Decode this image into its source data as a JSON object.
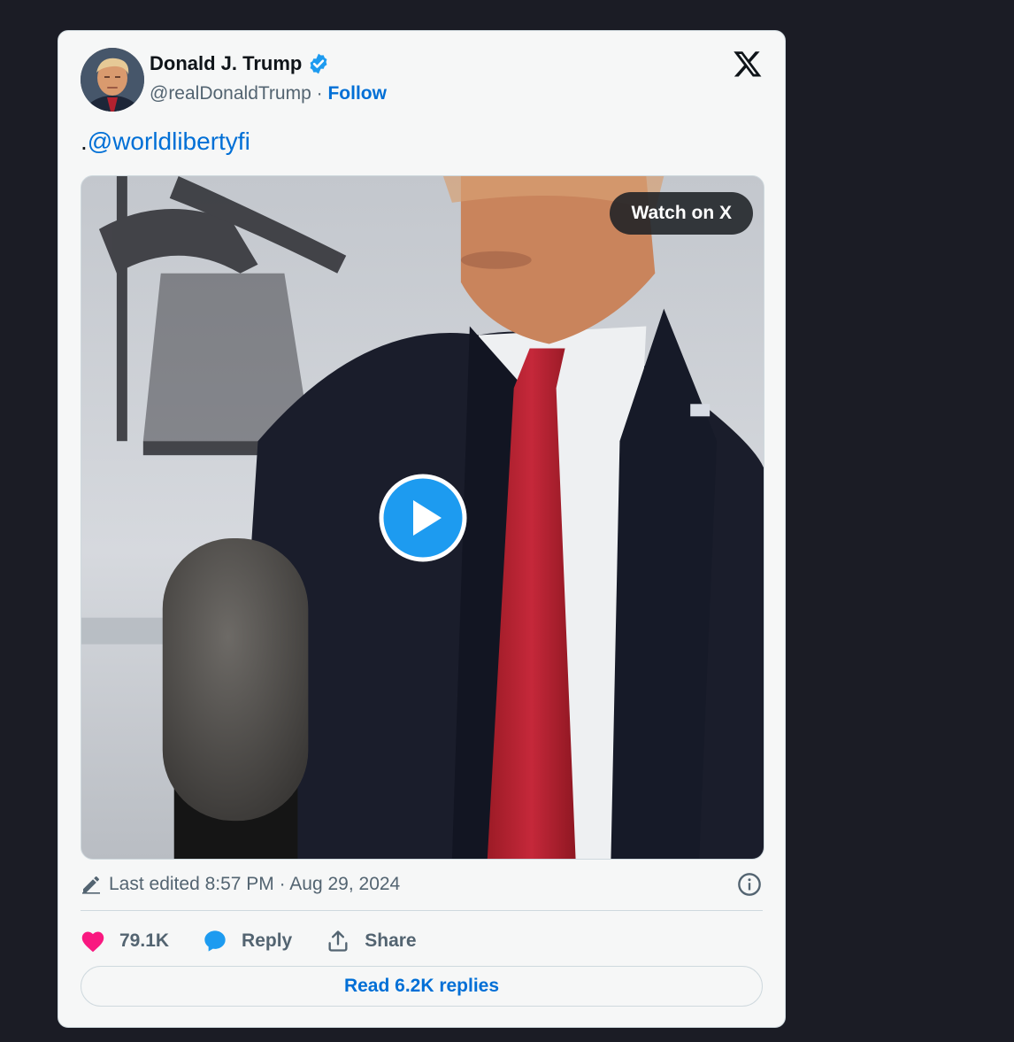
{
  "author": {
    "name": "Donald J. Trump",
    "handle": "@realDonaldTrump",
    "separator": "·",
    "follow_label": "Follow",
    "verified": true
  },
  "tweet": {
    "text_prefix": ".",
    "mention": "@worldlibertyfi"
  },
  "media": {
    "type": "video",
    "watch_label": "Watch on X"
  },
  "meta": {
    "edited_label": "Last edited 8:57 PM · Aug 29, 2024"
  },
  "actions": {
    "likes": "79.1K",
    "reply_label": "Reply",
    "share_label": "Share",
    "read_replies_label": "Read 6.2K replies"
  },
  "icons": {
    "brand": "x-logo-icon",
    "verified": "verified-badge-icon",
    "play": "play-icon",
    "edit": "pencil-icon",
    "info": "info-icon",
    "like": "heart-icon",
    "reply": "chat-bubble-icon",
    "share": "share-upload-icon"
  },
  "colors": {
    "page_bg": "#1b1c25",
    "card_bg": "#f6f7f7",
    "link": "#006fd6",
    "verified": "#1d9bf0",
    "like": "#f91880",
    "reply": "#1d9bf0",
    "muted": "#536471",
    "text": "#0f1419"
  }
}
